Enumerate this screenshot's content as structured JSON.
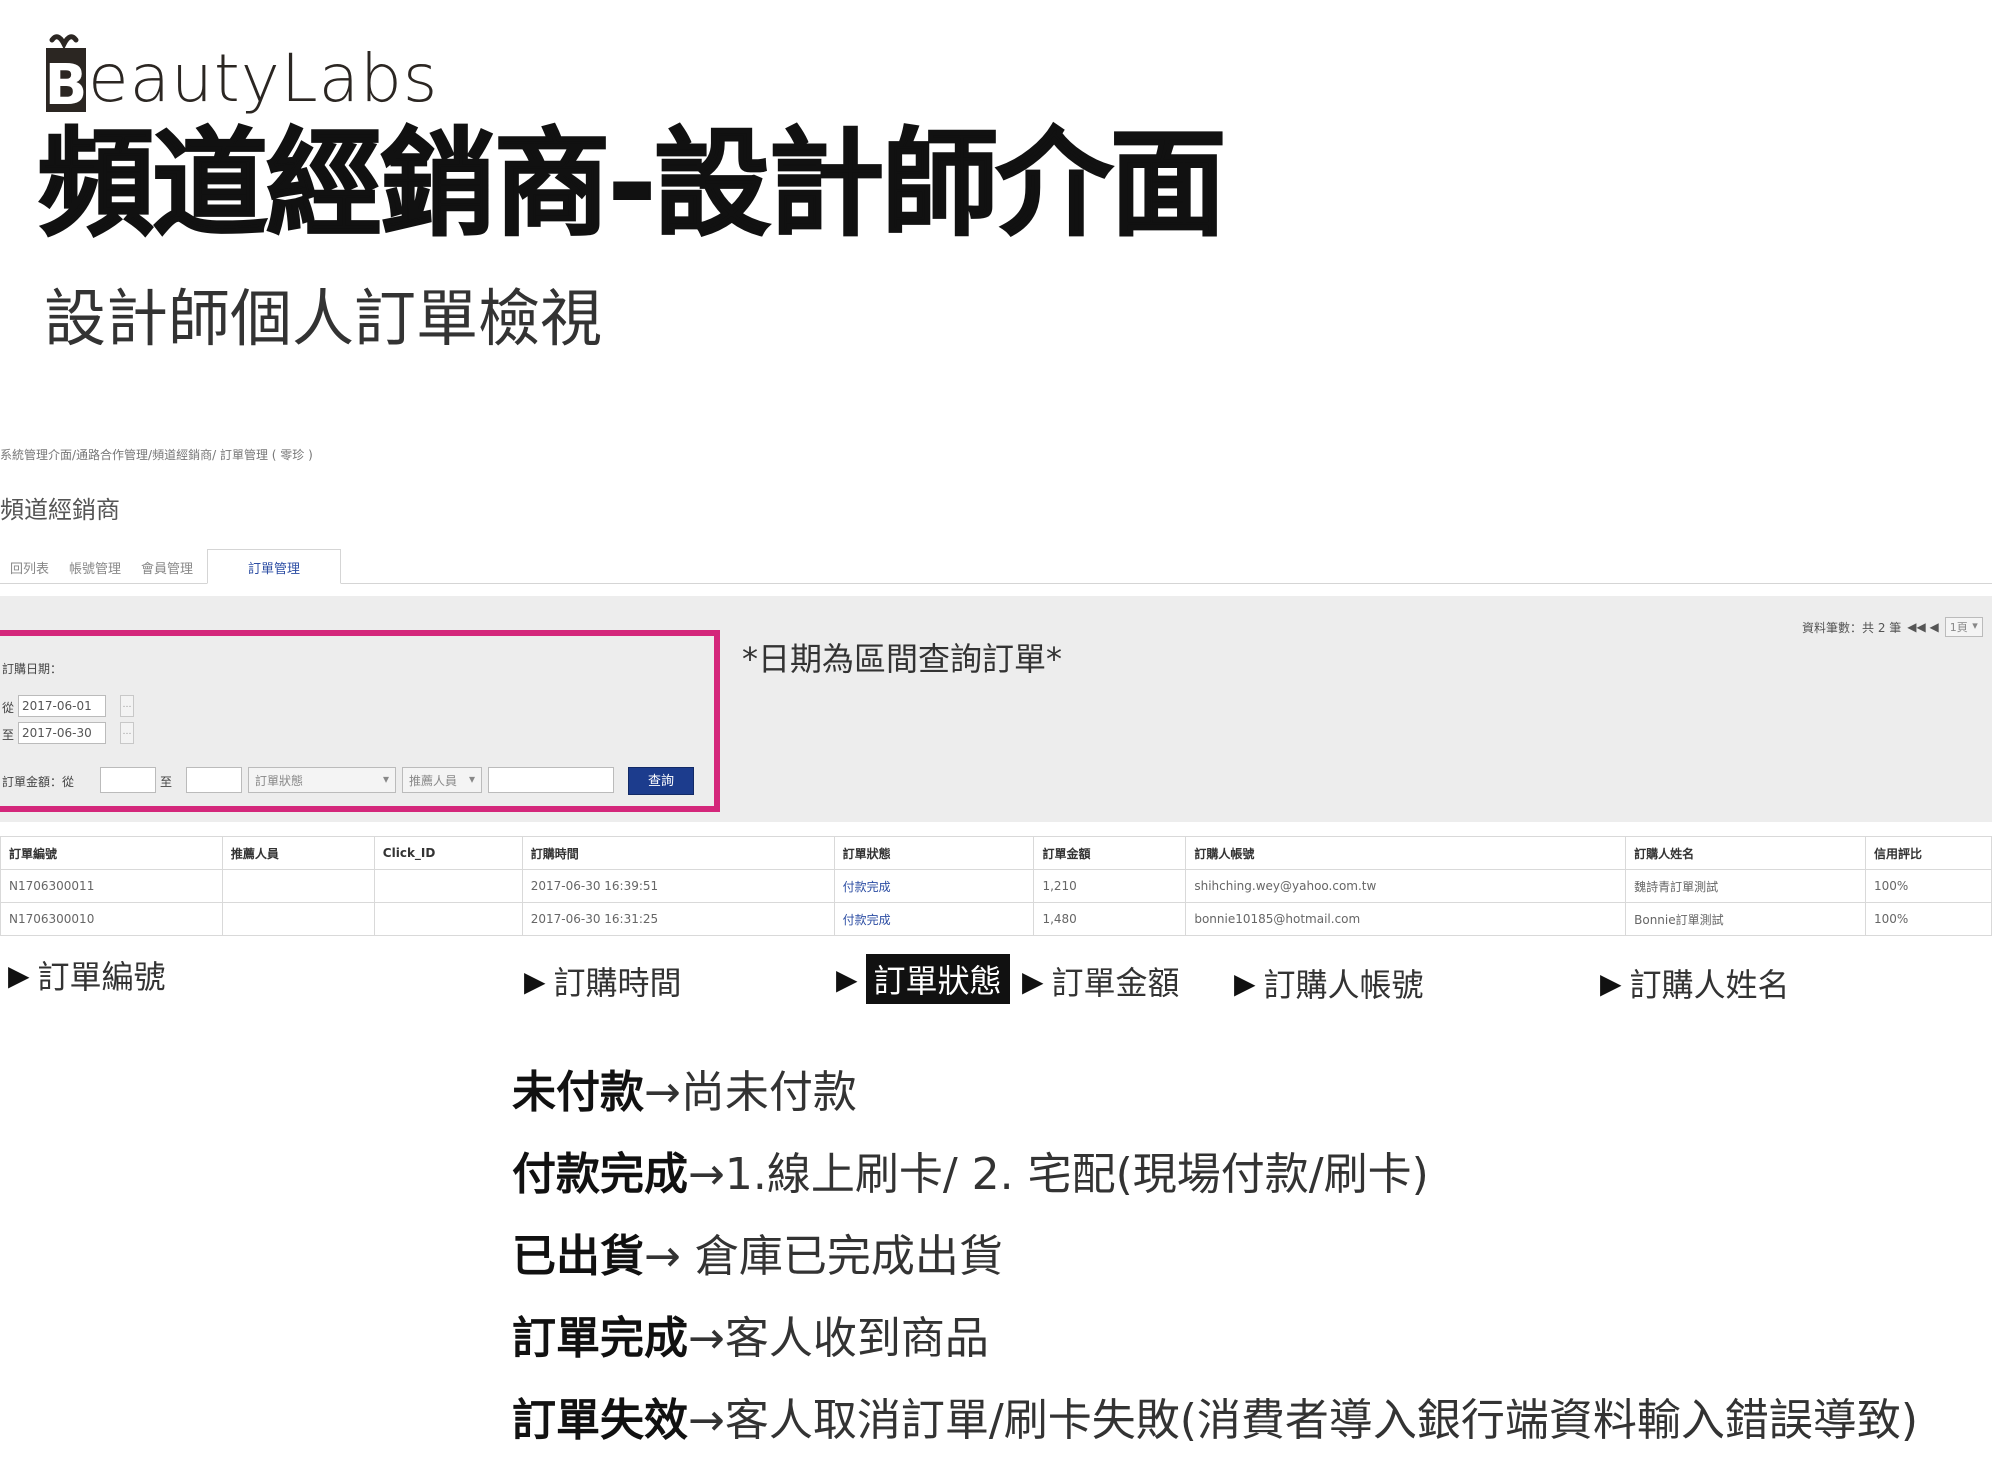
{
  "slide": {
    "logo_text": "eautyLabs",
    "logo_initial": "B",
    "title": "頻道經銷商-設計師介面",
    "subtitle": "設計師個人訂單檢視"
  },
  "admin": {
    "breadcrumb": "系統管理介面/通路合作管理/頻道經銷商/ 訂單管理 ( 零珍 )",
    "page_title": "頻道經銷商",
    "tabs": [
      {
        "label": "回列表"
      },
      {
        "label": "帳號管理"
      },
      {
        "label": "會員管理"
      },
      {
        "label": "訂單管理"
      }
    ],
    "search": {
      "order_date_label": "訂購日期：",
      "from_label": "從",
      "to_label": "至",
      "date_from": "2017-06-01",
      "date_to": "2017-06-30",
      "amount_label": "訂單金額：從",
      "amount_to_label": "至",
      "status_placeholder": "訂單狀態",
      "staff_placeholder": "推薦人員",
      "query_button": "查詢"
    },
    "note": "*日期為區間查詢訂單*",
    "pager": {
      "text": "資料筆數：共 2 筆",
      "nav": "◀◀ ◀",
      "page_select": "1頁"
    },
    "table": {
      "headers": [
        "訂單編號",
        "推薦人員",
        "Click_ID",
        "訂購時間",
        "訂單狀態",
        "訂單金額",
        "訂購人帳號",
        "訂購人姓名",
        "信用評比"
      ],
      "rows": [
        [
          "N1706300011",
          "",
          "",
          "2017-06-30 16:39:51",
          "付款完成",
          "1,210",
          "shihching.wey@yahoo.com.tw",
          "魏詩青訂單測試",
          "100%"
        ],
        [
          "N1706300010",
          "",
          "",
          "2017-06-30 16:31:25",
          "付款完成",
          "1,480",
          "bonnie10185@hotmail.com",
          "Bonnie訂單測試",
          "100%"
        ]
      ]
    }
  },
  "annotations": [
    {
      "label": "訂單編號",
      "highlighted": false
    },
    {
      "label": "訂購時間",
      "highlighted": false
    },
    {
      "label": "訂單狀態",
      "highlighted": true
    },
    {
      "label": "訂單金額",
      "highlighted": false
    },
    {
      "label": "訂購人帳號",
      "highlighted": false
    },
    {
      "label": "訂購人姓名",
      "highlighted": false
    }
  ],
  "status_definitions": [
    {
      "key": "未付款",
      "arrow": "→",
      "desc": "尚未付款"
    },
    {
      "key": "付款完成",
      "arrow": "→",
      "desc": "1.線上刷卡/ 2. 宅配(現場付款/刷卡)"
    },
    {
      "key": "已出貨",
      "arrow": "→",
      "desc": " 倉庫已完成出貨"
    },
    {
      "key": "訂單完成",
      "arrow": "→",
      "desc": "客人收到商品"
    },
    {
      "key": "訂單失效",
      "arrow": "→",
      "desc": "客人取消訂單/刷卡失敗(消費者導入銀行端資料輸入錯誤導致)"
    }
  ],
  "colors": {
    "highlight_box": "#d4277b",
    "query_button": "#1c3c8d",
    "link": "#2c4da3",
    "search_bg": "#ededed"
  },
  "icons": {
    "annotation_marker": "triangle-right-icon",
    "calendar_button": "calendar-icon",
    "select_arrow": "chevron-down-icon"
  }
}
